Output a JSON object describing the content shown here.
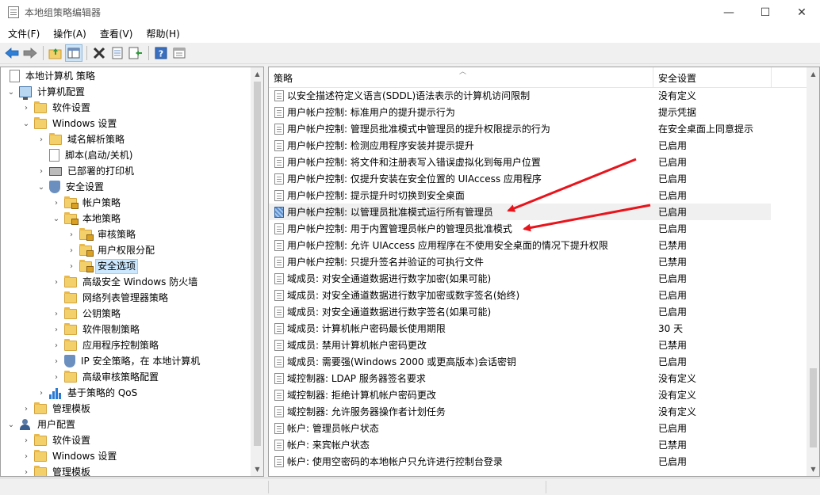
{
  "window": {
    "title": "本地组策略编辑器",
    "minimize": "—",
    "maximize": "☐",
    "close": "✕"
  },
  "menu": [
    "文件(F)",
    "操作(A)",
    "查看(V)",
    "帮助(H)"
  ],
  "toolbar": {
    "icons": [
      "back-icon",
      "forward-icon",
      "up-folder-icon",
      "show-hide-tree-icon",
      "delete-icon",
      "properties-icon",
      "export-list-icon",
      "help-icon",
      "view-icon"
    ]
  },
  "tree": [
    {
      "label": "本地计算机 策略",
      "icon": "doc",
      "level": 0,
      "exp": ""
    },
    {
      "label": "计算机配置",
      "icon": "computer",
      "level": 0,
      "exp": "open"
    },
    {
      "label": "软件设置",
      "icon": "folder",
      "level": 1,
      "exp": "closed"
    },
    {
      "label": "Windows 设置",
      "icon": "folder",
      "level": 1,
      "exp": "open"
    },
    {
      "label": "域名解析策略",
      "icon": "folder",
      "level": 2,
      "exp": "closed"
    },
    {
      "label": "脚本(启动/关机)",
      "icon": "doc",
      "level": 2,
      "exp": ""
    },
    {
      "label": "已部署的打印机",
      "icon": "printer",
      "level": 2,
      "exp": "closed"
    },
    {
      "label": "安全设置",
      "icon": "shield",
      "level": 2,
      "exp": "open"
    },
    {
      "label": "帐户策略",
      "icon": "lockfolder",
      "level": 3,
      "exp": "closed"
    },
    {
      "label": "本地策略",
      "icon": "lockfolder",
      "level": 3,
      "exp": "open"
    },
    {
      "label": "审核策略",
      "icon": "lockfolder",
      "level": 4,
      "exp": "closed"
    },
    {
      "label": "用户权限分配",
      "icon": "lockfolder",
      "level": 4,
      "exp": "closed"
    },
    {
      "label": "安全选项",
      "icon": "lockfolder",
      "level": 4,
      "exp": "closed",
      "selected": true
    },
    {
      "label": "高级安全 Windows 防火墙",
      "icon": "folder",
      "level": 3,
      "exp": "closed"
    },
    {
      "label": "网络列表管理器策略",
      "icon": "folder",
      "level": 3,
      "exp": ""
    },
    {
      "label": "公钥策略",
      "icon": "folder",
      "level": 3,
      "exp": "closed"
    },
    {
      "label": "软件限制策略",
      "icon": "folder",
      "level": 3,
      "exp": "closed"
    },
    {
      "label": "应用程序控制策略",
      "icon": "folder",
      "level": 3,
      "exp": "closed"
    },
    {
      "label": "IP 安全策略，在 本地计算机",
      "icon": "shield",
      "level": 3,
      "exp": "closed"
    },
    {
      "label": "高级审核策略配置",
      "icon": "folder",
      "level": 3,
      "exp": "closed"
    },
    {
      "label": "基于策略的 QoS",
      "icon": "chart",
      "level": 2,
      "exp": "closed"
    },
    {
      "label": "管理模板",
      "icon": "folder",
      "level": 1,
      "exp": "closed"
    },
    {
      "label": "用户配置",
      "icon": "user",
      "level": 0,
      "exp": "open"
    },
    {
      "label": "软件设置",
      "icon": "folder",
      "level": 1,
      "exp": "closed"
    },
    {
      "label": "Windows 设置",
      "icon": "folder",
      "level": 1,
      "exp": "closed"
    },
    {
      "label": "管理模板",
      "icon": "folder",
      "level": 1,
      "exp": "closed"
    }
  ],
  "list": {
    "col_policy": "策略",
    "col_setting": "安全设置",
    "rows": [
      {
        "name": "以安全描述符定义语言(SDDL)语法表示的计算机访问限制",
        "value": "没有定义"
      },
      {
        "name": "用户帐户控制: 标准用户的提升提示行为",
        "value": "提示凭据"
      },
      {
        "name": "用户帐户控制: 管理员批准模式中管理员的提升权限提示的行为",
        "value": "在安全桌面上同意提示"
      },
      {
        "name": "用户帐户控制: 检测应用程序安装并提示提升",
        "value": "已启用"
      },
      {
        "name": "用户帐户控制: 将文件和注册表写入错误虚拟化到每用户位置",
        "value": "已启用"
      },
      {
        "name": "用户帐户控制: 仅提升安装在安全位置的 UIAccess 应用程序",
        "value": "已启用"
      },
      {
        "name": "用户帐户控制: 提示提升时切换到安全桌面",
        "value": "已启用"
      },
      {
        "name": "用户帐户控制: 以管理员批准模式运行所有管理员",
        "value": "已启用",
        "highlight": true
      },
      {
        "name": "用户帐户控制: 用于内置管理员帐户的管理员批准模式",
        "value": "已启用"
      },
      {
        "name": "用户帐户控制: 允许 UIAccess 应用程序在不使用安全桌面的情况下提升权限",
        "value": "已禁用"
      },
      {
        "name": "用户帐户控制: 只提升签名并验证的可执行文件",
        "value": "已禁用"
      },
      {
        "name": "域成员: 对安全通道数据进行数字加密(如果可能)",
        "value": "已启用"
      },
      {
        "name": "域成员: 对安全通道数据进行数字加密或数字签名(始终)",
        "value": "已启用"
      },
      {
        "name": "域成员: 对安全通道数据进行数字签名(如果可能)",
        "value": "已启用"
      },
      {
        "name": "域成员: 计算机帐户密码最长使用期限",
        "value": "30 天"
      },
      {
        "name": "域成员: 禁用计算机帐户密码更改",
        "value": "已禁用"
      },
      {
        "name": "域成员: 需要强(Windows 2000 或更高版本)会话密钥",
        "value": "已启用"
      },
      {
        "name": "域控制器: LDAP 服务器签名要求",
        "value": "没有定义"
      },
      {
        "name": "域控制器: 拒绝计算机帐户密码更改",
        "value": "没有定义"
      },
      {
        "name": "域控制器: 允许服务器操作者计划任务",
        "value": "没有定义"
      },
      {
        "name": "帐户: 管理员帐户状态",
        "value": "已启用"
      },
      {
        "name": "帐户: 来宾帐户状态",
        "value": "已禁用"
      },
      {
        "name": "帐户: 使用空密码的本地帐户只允许进行控制台登录",
        "value": "已启用"
      }
    ]
  },
  "colors": {
    "arrow": "#e8141c",
    "selection": "#cce8ff"
  }
}
